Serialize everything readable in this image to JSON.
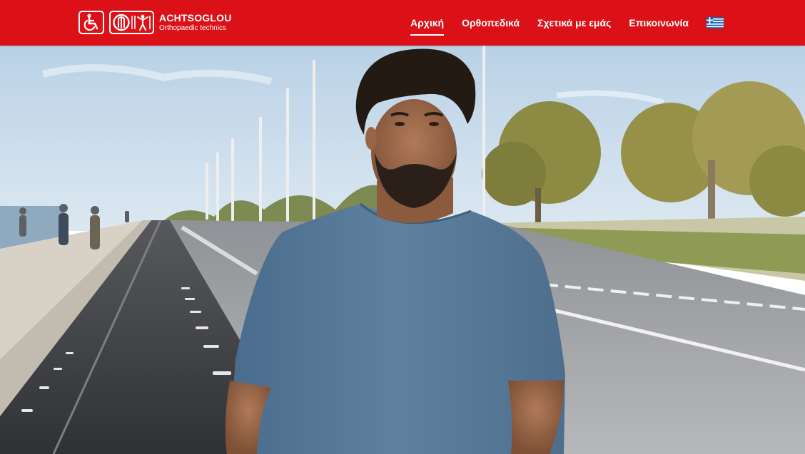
{
  "brand": {
    "name": "ACHTSOGLOU",
    "tagline": "Orthopaedic technics",
    "wheelchair_icon": "wheelchair-icon",
    "logo_icon": "orthopaedic-logo-icon"
  },
  "nav": {
    "items": [
      {
        "label": "Αρχική",
        "active": true
      },
      {
        "label": "Ορθοπεδικά",
        "active": false
      },
      {
        "label": "Σχετικά με εμάς",
        "active": false
      },
      {
        "label": "Επικοινωνία",
        "active": false
      }
    ],
    "language_icon": "greek-flag-icon"
  },
  "hero": {
    "type": "video-background"
  },
  "colors": {
    "brand_red": "#dc1118",
    "text_on_brand": "#ffffff"
  }
}
